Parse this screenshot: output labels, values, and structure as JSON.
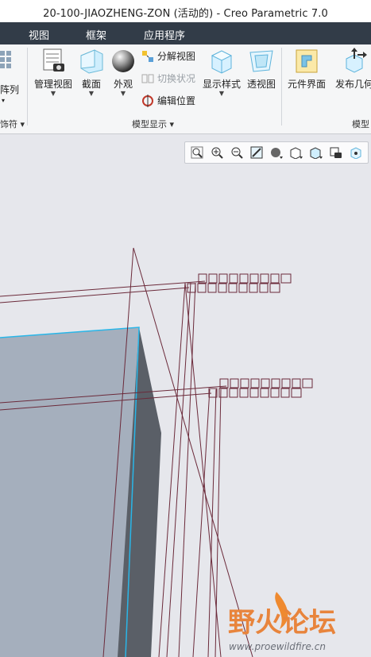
{
  "window": {
    "title": "20-100-JIAOZHENG-ZON (活动的) - Creo Parametric 7.0"
  },
  "menu": [
    "视图",
    "框架",
    "应用程序"
  ],
  "ribbon": {
    "partial_left": {
      "top_label": "阵列",
      "bottom_label": "饰符"
    },
    "manage_view": "管理视图",
    "section": "截面",
    "appearance": "外观",
    "explode_view": "分解视图",
    "toggle_state": "切换状况",
    "edit_position": "编辑位置",
    "display_style": "显示样式",
    "perspective": "透视图",
    "group_model_display": "模型显示",
    "component_interface": "元件界面",
    "publish_geometry": "发布几何",
    "group_model": "模型"
  },
  "view_toolbar": {
    "buttons": [
      "refit-icon",
      "zoom-in-icon",
      "zoom-out-icon",
      "repaint-icon",
      "display-style-icon",
      "named-views-icon",
      "saved-orientations-icon",
      "camera-icon",
      "spin-center-icon"
    ]
  },
  "watermark": {
    "text": "野火论坛",
    "url": "www.proewildfire.cn"
  },
  "colors": {
    "menubar": "#323c48",
    "edge_highlight": "#29b6e8",
    "datum_lines": "#6b2a3a",
    "model_face": "#a5afbd",
    "model_side": "#5a5f67"
  }
}
